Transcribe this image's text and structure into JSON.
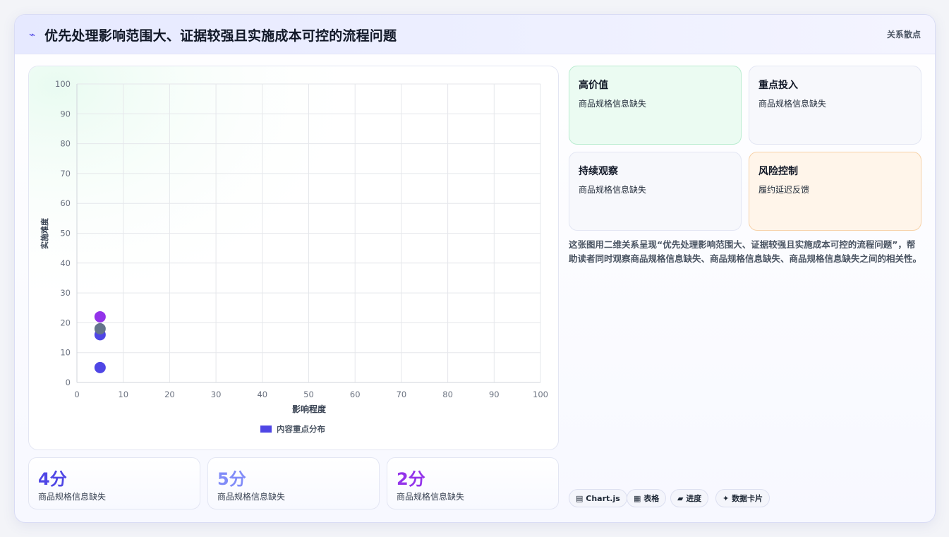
{
  "header": {
    "icon": "lightning-icon",
    "title": "优先处理影响范围大、证据较强且实施成本可控的流程问题",
    "tag": "关系散点"
  },
  "chart_data": {
    "type": "scatter",
    "xlabel": "影响程度",
    "ylabel": "实施难度",
    "xlim": [
      0,
      100
    ],
    "ylim": [
      0,
      100
    ],
    "xticks": [
      0,
      10,
      20,
      30,
      40,
      50,
      60,
      70,
      80,
      90,
      100
    ],
    "yticks": [
      0,
      10,
      20,
      30,
      40,
      50,
      60,
      70,
      80,
      90,
      100
    ],
    "grid": true,
    "legend": {
      "position": "bottom",
      "label": "内容重点分布",
      "color": "#4f46e5"
    },
    "points": [
      {
        "x": 5,
        "y": 5,
        "color": "#4f46e5"
      },
      {
        "x": 5,
        "y": 16,
        "color": "#4f46e5"
      },
      {
        "x": 5,
        "y": 22,
        "color": "#9333ea"
      },
      {
        "x": 5,
        "y": 18,
        "color": "#64748b"
      }
    ]
  },
  "stats": [
    {
      "value": "4分",
      "label": "商品规格信息缺失",
      "color": "#4f46e5"
    },
    {
      "value": "5分",
      "label": "商品规格信息缺失",
      "color": "#818cf8"
    },
    {
      "value": "2分",
      "label": "商品规格信息缺失",
      "color": "#9333ea"
    }
  ],
  "quadrants": [
    {
      "title": "高价值",
      "item": "商品规格信息缺失"
    },
    {
      "title": "重点投入",
      "item": "商品规格信息缺失"
    },
    {
      "title": "持续观察",
      "item": "商品规格信息缺失"
    },
    {
      "title": "风险控制",
      "item": "履约延迟反馈"
    }
  ],
  "description": "这张图用二维关系呈现“优先处理影响范围大、证据较强且实施成本可控的流程问题”，帮助读者同时观察商品规格信息缺失、商品规格信息缺失、商品规格信息缺失之间的相关性。",
  "pills": [
    {
      "icon": "chart-icon",
      "glyph": "▤",
      "label": "Chart.js"
    },
    {
      "icon": "table-icon",
      "glyph": "▦",
      "label": "表格"
    },
    {
      "icon": "progress-icon",
      "glyph": "▰",
      "label": "进度"
    },
    {
      "icon": "card-icon",
      "glyph": "✦",
      "label": "数据卡片"
    }
  ]
}
